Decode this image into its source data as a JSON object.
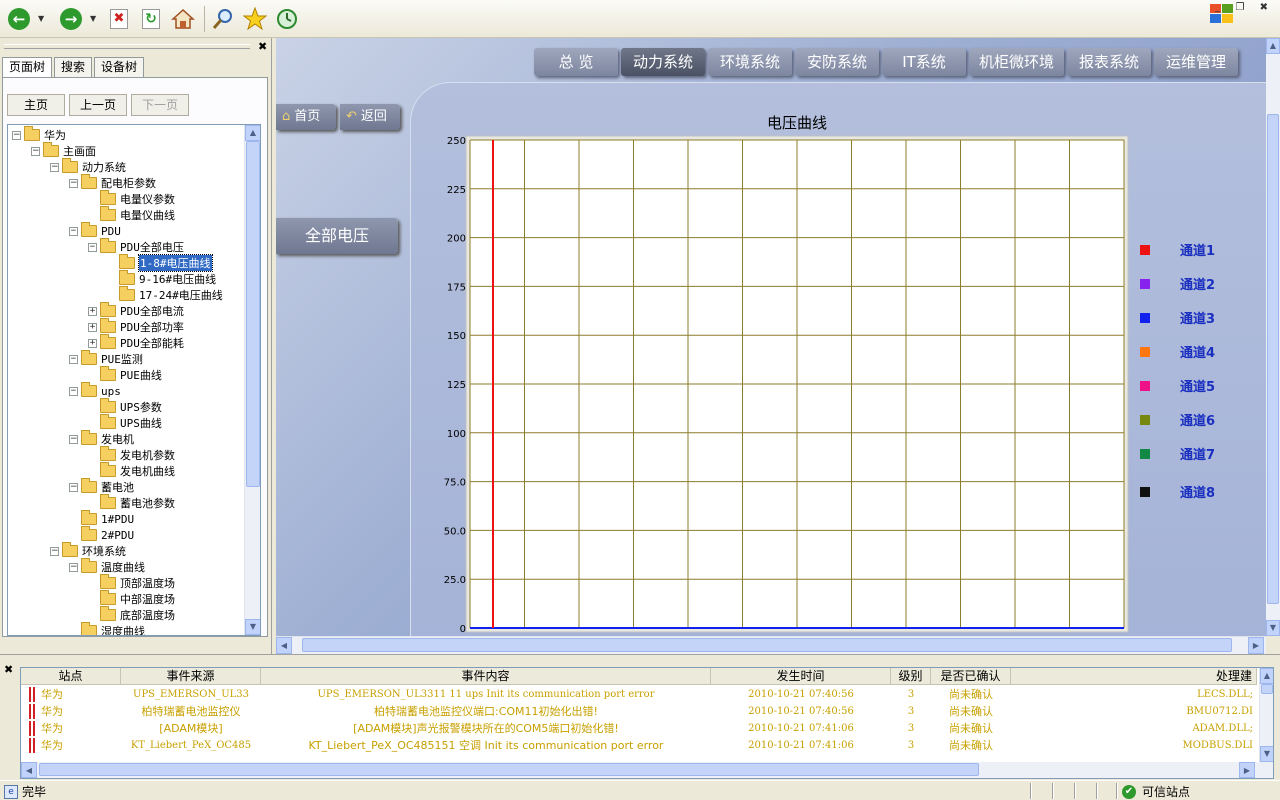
{
  "toolbar": {
    "buttons": [
      "back-icon",
      "forward-icon",
      "stop-icon",
      "refresh-icon",
      "home-icon",
      "search-icon",
      "favorites-icon",
      "history-icon"
    ]
  },
  "left_panel": {
    "tabs": [
      "页面树",
      "搜索",
      "设备树"
    ],
    "nav_buttons": [
      "主页",
      "上一页",
      "下一页"
    ],
    "tree": [
      {
        "label": "华为",
        "level": 0,
        "box": "-"
      },
      {
        "label": "主画面",
        "level": 1,
        "box": "-"
      },
      {
        "label": "动力系统",
        "level": 2,
        "box": "-"
      },
      {
        "label": "配电柜参数",
        "level": 3,
        "box": "-"
      },
      {
        "label": "电量仪参数",
        "level": 4,
        "box": ""
      },
      {
        "label": "电量仪曲线",
        "level": 4,
        "box": ""
      },
      {
        "label": "PDU",
        "level": 3,
        "box": "-"
      },
      {
        "label": "PDU全部电压",
        "level": 4,
        "box": "-"
      },
      {
        "label": "1-8#电压曲线",
        "level": 5,
        "box": "",
        "selected": true
      },
      {
        "label": "9-16#电压曲线",
        "level": 5,
        "box": ""
      },
      {
        "label": "17-24#电压曲线",
        "level": 5,
        "box": ""
      },
      {
        "label": "PDU全部电流",
        "level": 4,
        "box": "+"
      },
      {
        "label": "PDU全部功率",
        "level": 4,
        "box": "+"
      },
      {
        "label": "PDU全部能耗",
        "level": 4,
        "box": "+"
      },
      {
        "label": "PUE监测",
        "level": 3,
        "box": "-"
      },
      {
        "label": "PUE曲线",
        "level": 4,
        "box": ""
      },
      {
        "label": "ups",
        "level": 3,
        "box": "-"
      },
      {
        "label": "UPS参数",
        "level": 4,
        "box": ""
      },
      {
        "label": "UPS曲线",
        "level": 4,
        "box": ""
      },
      {
        "label": "发电机",
        "level": 3,
        "box": "-"
      },
      {
        "label": "发电机参数",
        "level": 4,
        "box": ""
      },
      {
        "label": "发电机曲线",
        "level": 4,
        "box": ""
      },
      {
        "label": "蓄电池",
        "level": 3,
        "box": "-"
      },
      {
        "label": "蓄电池参数",
        "level": 4,
        "box": ""
      },
      {
        "label": "1#PDU",
        "level": 3,
        "box": ""
      },
      {
        "label": "2#PDU",
        "level": 3,
        "box": ""
      },
      {
        "label": "环境系统",
        "level": 2,
        "box": "-"
      },
      {
        "label": "温度曲线",
        "level": 3,
        "box": "-"
      },
      {
        "label": "顶部温度场",
        "level": 4,
        "box": ""
      },
      {
        "label": "中部温度场",
        "level": 4,
        "box": ""
      },
      {
        "label": "底部温度场",
        "level": 4,
        "box": ""
      },
      {
        "label": "湿度曲线",
        "level": 3,
        "box": ""
      }
    ]
  },
  "main": {
    "nav_tabs": [
      "总 览",
      "动力系统",
      "环境系统",
      "安防系统",
      "IT系统",
      "机柜微环境",
      "报表系统",
      "运维管理"
    ],
    "active_tab": "动力系统",
    "home_button": "首页",
    "back_button": "返回",
    "all_voltage_button": "全部电压"
  },
  "chart_data": {
    "type": "line",
    "title": "电压曲线",
    "ylim": [
      0,
      250
    ],
    "y_ticks": [
      "0",
      "25.0",
      "50.0",
      "75.0",
      "100",
      "125",
      "150",
      "175",
      "200",
      "225",
      "250"
    ],
    "grid": true,
    "legend_position": "right",
    "series": [
      {
        "name": "通道1",
        "color": "#ee1111"
      },
      {
        "name": "通道2",
        "color": "#8822ee"
      },
      {
        "name": "通道3",
        "color": "#1122ee"
      },
      {
        "name": "通道4",
        "color": "#ff7711"
      },
      {
        "name": "通道5",
        "color": "#ee1188"
      },
      {
        "name": "通道6",
        "color": "#778811"
      },
      {
        "name": "通道7",
        "color": "#118844"
      },
      {
        "name": "通道8",
        "color": "#111111"
      }
    ],
    "colors": {
      "grid": "#8b7d2a",
      "baseline": "#1122ee",
      "marker": "#ee1111",
      "plot_bg": "#ffffff"
    }
  },
  "events": {
    "columns": [
      "站点",
      "事件来源",
      "事件内容",
      "发生时间",
      "级别",
      "是否已确认",
      "处理建"
    ],
    "rows": [
      [
        "华为",
        "UPS_EMERSON_UL33",
        "UPS_EMERSON_UL3311 11 ups Init its communication port error",
        "2010-10-21 07:40:56",
        "3",
        "尚未确认",
        "LECS.DLL;"
      ],
      [
        "华为",
        "柏特瑞蓄电池监控仪",
        "柏特瑞蓄电池监控仪端口:COM11初始化出错!",
        "2010-10-21 07:40:56",
        "3",
        "尚未确认",
        "BMU0712.DI"
      ],
      [
        "华为",
        "[ADAM模块]",
        "[ADAM模块]声光报警模块所在的COM5端口初始化错!",
        "2010-10-21 07:41:06",
        "3",
        "尚未确认",
        "ADAM.DLL;"
      ],
      [
        "华为",
        "KT_Liebert_PeX_OC485",
        "KT_Liebert_PeX_OC485151 空调 Init its communication port error",
        "2010-10-21 07:41:06",
        "3",
        "尚未确认",
        "MODBUS.DLI"
      ]
    ]
  },
  "status": {
    "left": "完毕",
    "right": "可信站点"
  }
}
